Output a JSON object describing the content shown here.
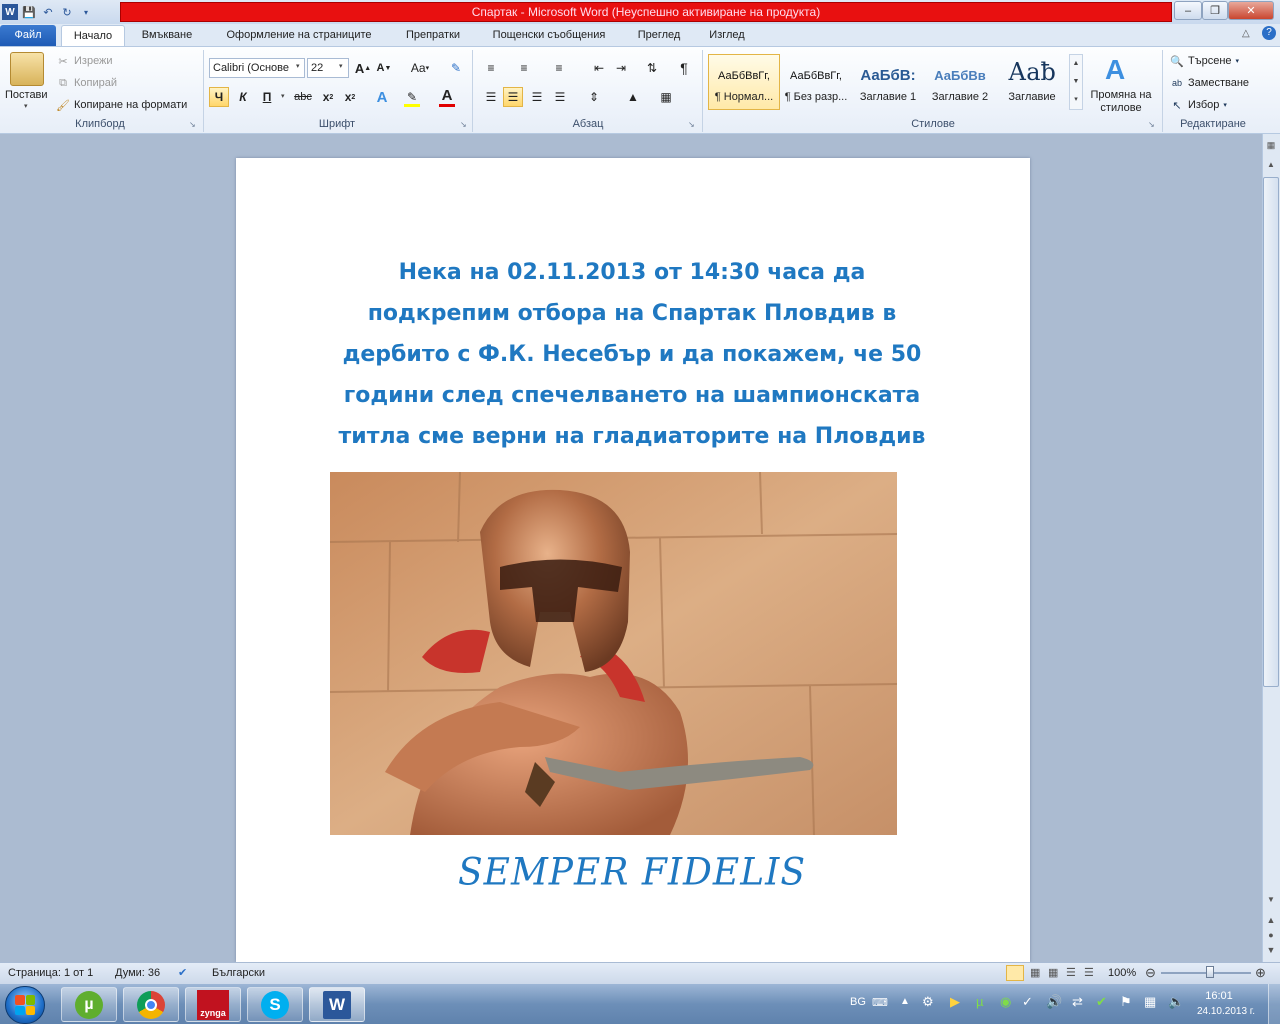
{
  "window": {
    "title": "Спартак - Microsoft Word (Неуспешно активиране на продукта)",
    "title_bar_color": "#e81010"
  },
  "tabs": {
    "file": "Файл",
    "items": [
      "Начало",
      "Вмъкване",
      "Оформление на страниците",
      "Препратки",
      "Пощенски съобщения",
      "Преглед",
      "Изглед"
    ],
    "active": "Начало"
  },
  "ribbon": {
    "clipboard": {
      "label": "Клипборд",
      "paste": "Постави",
      "cut": "Изрежи",
      "copy": "Копирай",
      "format_painter": "Копиране на формати"
    },
    "font": {
      "label": "Шрифт",
      "font_name": "Calibri (Основе",
      "font_size": "22",
      "grow": "A",
      "shrink": "A",
      "change_case": "Aa",
      "bold": "Ч",
      "italic": "К",
      "underline": "П",
      "strike": "abc",
      "subscript": "x",
      "superscript": "x"
    },
    "paragraph": {
      "label": "Абзац"
    },
    "styles": {
      "label": "Стилове",
      "items": [
        {
          "sample": "АаБбВвГг,",
          "name": "¶ Нормал..."
        },
        {
          "sample": "АаБбВвГг,",
          "name": "¶ Без разр..."
        },
        {
          "sample": "АаБбВ:",
          "name": "Заглавие 1"
        },
        {
          "sample": "АаБбВв",
          "name": "Заглавие 2"
        },
        {
          "sample": "Аа",
          "name": "Заглавие"
        }
      ],
      "change_styles": "Промяна на стилове"
    },
    "editing": {
      "label": "Редактиране",
      "find": "Търсене",
      "replace": "Заместване",
      "select": "Избор"
    }
  },
  "document": {
    "lines": [
      "Нека на  02.11.2013 от 14:30 часа  да",
      "подкрепим отбора на Спартак Пловдив в",
      "дербито с Ф.К. Несебър и да покажем, че 50",
      "години след спечелването на шампионската",
      "титла сме верни на гладиаторите на Пловдив"
    ],
    "motto": "SEMPER FIDELIS",
    "text_color": "#1f78c1"
  },
  "status": {
    "page": "Страница: 1 от 1",
    "words": "Думи: 36",
    "language": "Български",
    "zoom": "100%"
  },
  "taskbar": {
    "apps": [
      "uTorrent",
      "Chrome",
      "Zynga",
      "Skype",
      "Word"
    ],
    "zynga_label": "zynga",
    "lang": "BG",
    "time": "16:01",
    "date": "24.10.2013 г."
  }
}
